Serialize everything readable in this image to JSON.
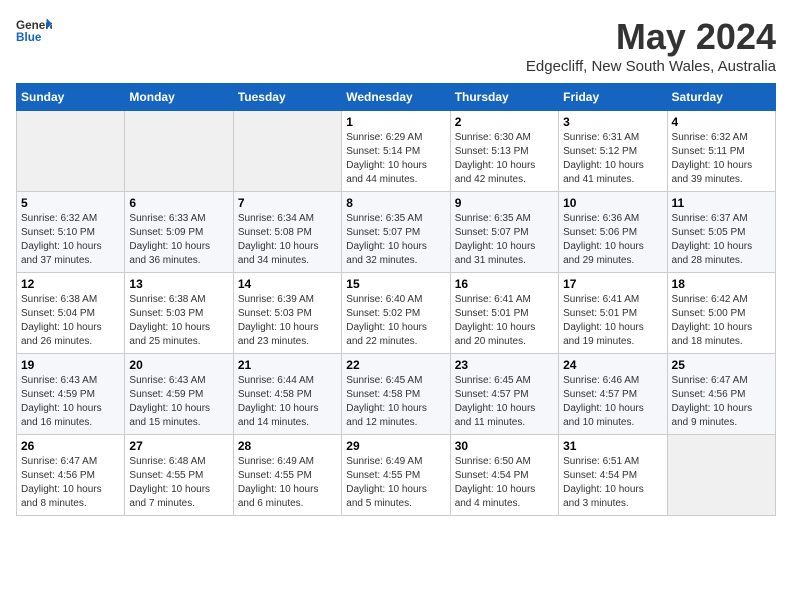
{
  "header": {
    "logo_line1": "General",
    "logo_line2": "Blue",
    "title": "May 2024",
    "subtitle": "Edgecliff, New South Wales, Australia"
  },
  "days_of_week": [
    "Sunday",
    "Monday",
    "Tuesday",
    "Wednesday",
    "Thursday",
    "Friday",
    "Saturday"
  ],
  "weeks": [
    [
      {
        "num": "",
        "info": ""
      },
      {
        "num": "",
        "info": ""
      },
      {
        "num": "",
        "info": ""
      },
      {
        "num": "1",
        "info": "Sunrise: 6:29 AM\nSunset: 5:14 PM\nDaylight: 10 hours\nand 44 minutes."
      },
      {
        "num": "2",
        "info": "Sunrise: 6:30 AM\nSunset: 5:13 PM\nDaylight: 10 hours\nand 42 minutes."
      },
      {
        "num": "3",
        "info": "Sunrise: 6:31 AM\nSunset: 5:12 PM\nDaylight: 10 hours\nand 41 minutes."
      },
      {
        "num": "4",
        "info": "Sunrise: 6:32 AM\nSunset: 5:11 PM\nDaylight: 10 hours\nand 39 minutes."
      }
    ],
    [
      {
        "num": "5",
        "info": "Sunrise: 6:32 AM\nSunset: 5:10 PM\nDaylight: 10 hours\nand 37 minutes."
      },
      {
        "num": "6",
        "info": "Sunrise: 6:33 AM\nSunset: 5:09 PM\nDaylight: 10 hours\nand 36 minutes."
      },
      {
        "num": "7",
        "info": "Sunrise: 6:34 AM\nSunset: 5:08 PM\nDaylight: 10 hours\nand 34 minutes."
      },
      {
        "num": "8",
        "info": "Sunrise: 6:35 AM\nSunset: 5:07 PM\nDaylight: 10 hours\nand 32 minutes."
      },
      {
        "num": "9",
        "info": "Sunrise: 6:35 AM\nSunset: 5:07 PM\nDaylight: 10 hours\nand 31 minutes."
      },
      {
        "num": "10",
        "info": "Sunrise: 6:36 AM\nSunset: 5:06 PM\nDaylight: 10 hours\nand 29 minutes."
      },
      {
        "num": "11",
        "info": "Sunrise: 6:37 AM\nSunset: 5:05 PM\nDaylight: 10 hours\nand 28 minutes."
      }
    ],
    [
      {
        "num": "12",
        "info": "Sunrise: 6:38 AM\nSunset: 5:04 PM\nDaylight: 10 hours\nand 26 minutes."
      },
      {
        "num": "13",
        "info": "Sunrise: 6:38 AM\nSunset: 5:03 PM\nDaylight: 10 hours\nand 25 minutes."
      },
      {
        "num": "14",
        "info": "Sunrise: 6:39 AM\nSunset: 5:03 PM\nDaylight: 10 hours\nand 23 minutes."
      },
      {
        "num": "15",
        "info": "Sunrise: 6:40 AM\nSunset: 5:02 PM\nDaylight: 10 hours\nand 22 minutes."
      },
      {
        "num": "16",
        "info": "Sunrise: 6:41 AM\nSunset: 5:01 PM\nDaylight: 10 hours\nand 20 minutes."
      },
      {
        "num": "17",
        "info": "Sunrise: 6:41 AM\nSunset: 5:01 PM\nDaylight: 10 hours\nand 19 minutes."
      },
      {
        "num": "18",
        "info": "Sunrise: 6:42 AM\nSunset: 5:00 PM\nDaylight: 10 hours\nand 18 minutes."
      }
    ],
    [
      {
        "num": "19",
        "info": "Sunrise: 6:43 AM\nSunset: 4:59 PM\nDaylight: 10 hours\nand 16 minutes."
      },
      {
        "num": "20",
        "info": "Sunrise: 6:43 AM\nSunset: 4:59 PM\nDaylight: 10 hours\nand 15 minutes."
      },
      {
        "num": "21",
        "info": "Sunrise: 6:44 AM\nSunset: 4:58 PM\nDaylight: 10 hours\nand 14 minutes."
      },
      {
        "num": "22",
        "info": "Sunrise: 6:45 AM\nSunset: 4:58 PM\nDaylight: 10 hours\nand 12 minutes."
      },
      {
        "num": "23",
        "info": "Sunrise: 6:45 AM\nSunset: 4:57 PM\nDaylight: 10 hours\nand 11 minutes."
      },
      {
        "num": "24",
        "info": "Sunrise: 6:46 AM\nSunset: 4:57 PM\nDaylight: 10 hours\nand 10 minutes."
      },
      {
        "num": "25",
        "info": "Sunrise: 6:47 AM\nSunset: 4:56 PM\nDaylight: 10 hours\nand 9 minutes."
      }
    ],
    [
      {
        "num": "26",
        "info": "Sunrise: 6:47 AM\nSunset: 4:56 PM\nDaylight: 10 hours\nand 8 minutes."
      },
      {
        "num": "27",
        "info": "Sunrise: 6:48 AM\nSunset: 4:55 PM\nDaylight: 10 hours\nand 7 minutes."
      },
      {
        "num": "28",
        "info": "Sunrise: 6:49 AM\nSunset: 4:55 PM\nDaylight: 10 hours\nand 6 minutes."
      },
      {
        "num": "29",
        "info": "Sunrise: 6:49 AM\nSunset: 4:55 PM\nDaylight: 10 hours\nand 5 minutes."
      },
      {
        "num": "30",
        "info": "Sunrise: 6:50 AM\nSunset: 4:54 PM\nDaylight: 10 hours\nand 4 minutes."
      },
      {
        "num": "31",
        "info": "Sunrise: 6:51 AM\nSunset: 4:54 PM\nDaylight: 10 hours\nand 3 minutes."
      },
      {
        "num": "",
        "info": ""
      }
    ]
  ]
}
